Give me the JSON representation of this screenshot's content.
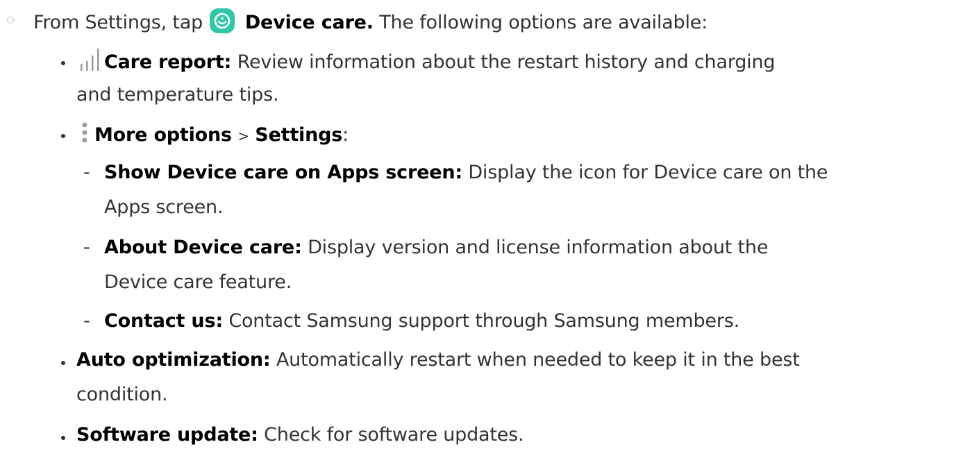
{
  "step": {
    "prefix": "From Settings, tap",
    "app_name": "Device care.",
    "suffix": "The following options are available:",
    "app_icon": "device-care-icon",
    "app_icon_color": "#2fc7a8"
  },
  "items": [
    {
      "icon": "bar-chart-icon",
      "title": "Care report",
      "colon": ":",
      "text_line1": "Review information about the restart history and charging",
      "text_line2": "and temperature tips."
    },
    {
      "icon": "more-options-icon",
      "title": "More options",
      "separator": ">",
      "title2": "Settings",
      "colon": ":",
      "subitems": [
        {
          "title": "Show Device care on Apps screen",
          "colon": ":",
          "text_line1": "Display the icon for Device care on the",
          "text_line2": "Apps screen."
        },
        {
          "title": "About Device care",
          "colon": ":",
          "text_line1": "Display version and license information about the",
          "text_line2": "Device care feature."
        },
        {
          "title": "Contact us",
          "colon": ":",
          "text_line1": "Contact Samsung support through Samsung members."
        }
      ]
    },
    {
      "title": "Auto optimization",
      "colon": ":",
      "text_line1": "Automatically restart when needed to keep it in the best",
      "text_line2": "condition."
    },
    {
      "title": "Software update",
      "colon": ":",
      "text_line1": "Check for software updates."
    }
  ],
  "dash": "-"
}
